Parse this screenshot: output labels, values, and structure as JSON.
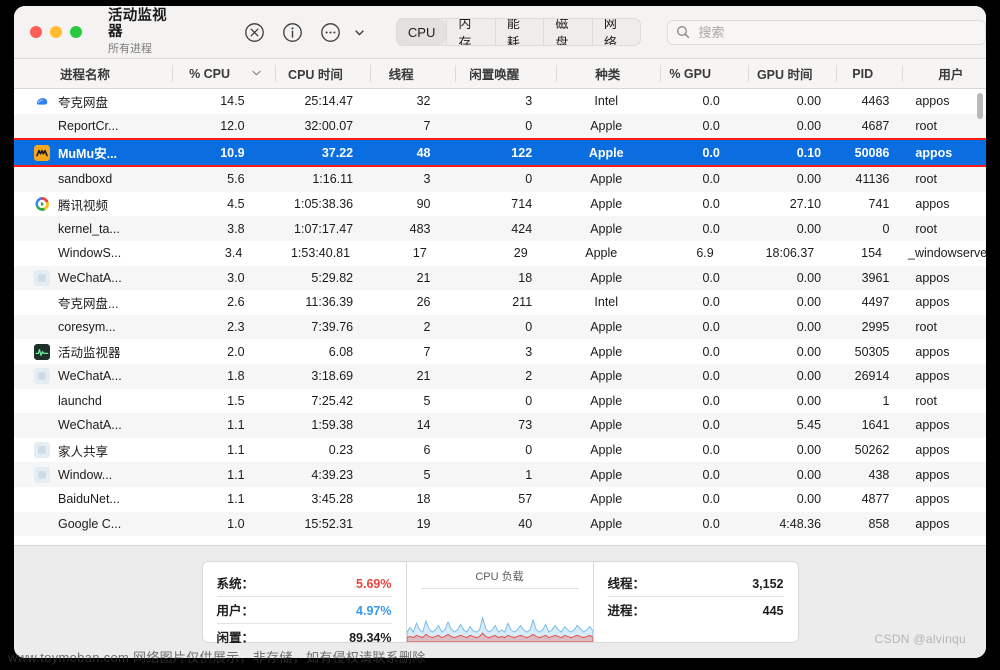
{
  "window": {
    "title": "活动监视器",
    "subtitle": "所有进程",
    "traffic_lights": [
      "close",
      "minimize",
      "maximize"
    ]
  },
  "toolbar": {
    "icons": [
      {
        "name": "stop-process-icon",
        "glyph": "x-circle"
      },
      {
        "name": "inspect-process-icon",
        "glyph": "i-circle"
      },
      {
        "name": "more-options-icon",
        "glyph": "ellipsis-circle"
      },
      {
        "name": "chevron-down-icon",
        "glyph": "chevron-down"
      }
    ],
    "tabs": [
      {
        "label": "CPU",
        "active": true
      },
      {
        "label": "内存",
        "active": false
      },
      {
        "label": "能耗",
        "active": false
      },
      {
        "label": "磁盘",
        "active": false
      },
      {
        "label": "网络",
        "active": false
      }
    ],
    "search": {
      "placeholder": "搜索",
      "value": ""
    }
  },
  "table": {
    "columns": [
      {
        "key": "name",
        "label": "进程名称"
      },
      {
        "key": "cpu",
        "label": "% CPU",
        "sorted": true,
        "sort_dir": "desc"
      },
      {
        "key": "cputime",
        "label": "CPU 时间"
      },
      {
        "key": "threads",
        "label": "线程"
      },
      {
        "key": "idlewake",
        "label": "闲置唤醒"
      },
      {
        "key": "kind",
        "label": "种类"
      },
      {
        "key": "gpu",
        "label": "% GPU"
      },
      {
        "key": "gputime",
        "label": "GPU 时间"
      },
      {
        "key": "pid",
        "label": "PID"
      },
      {
        "key": "user",
        "label": "用户"
      }
    ],
    "rows": [
      {
        "icon": "quark-cloud",
        "icon_color": "#2f80f0",
        "name": "夸克网盘",
        "cpu": "14.5",
        "cputime": "25:14.47",
        "threads": "32",
        "idlewake": "3",
        "kind": "Intel",
        "gpu": "0.0",
        "gputime": "0.00",
        "pid": "4463",
        "user": "appos",
        "selected": false
      },
      {
        "icon": "none",
        "icon_color": "",
        "name": "ReportCr...",
        "cpu": "12.0",
        "cputime": "32:00.07",
        "threads": "7",
        "idlewake": "0",
        "kind": "Apple",
        "gpu": "0.0",
        "gputime": "0.00",
        "pid": "4687",
        "user": "root",
        "selected": false
      },
      {
        "icon": "mumu",
        "icon_color": "#f5a623",
        "name": "MuMu安...",
        "cpu": "10.9",
        "cputime": "37.22",
        "threads": "48",
        "idlewake": "122",
        "kind": "Apple",
        "gpu": "0.0",
        "gputime": "0.10",
        "pid": "50086",
        "user": "appos",
        "selected": true
      },
      {
        "icon": "none",
        "icon_color": "",
        "name": "sandboxd",
        "cpu": "5.6",
        "cputime": "1:16.11",
        "threads": "3",
        "idlewake": "0",
        "kind": "Apple",
        "gpu": "0.0",
        "gputime": "0.00",
        "pid": "41136",
        "user": "root",
        "selected": false
      },
      {
        "icon": "tencent-video",
        "icon_color": "#ffffff",
        "name": "腾讯视频",
        "cpu": "4.5",
        "cputime": "1:05:38.36",
        "threads": "90",
        "idlewake": "714",
        "kind": "Apple",
        "gpu": "0.0",
        "gputime": "27.10",
        "pid": "741",
        "user": "appos",
        "selected": false
      },
      {
        "icon": "none",
        "icon_color": "",
        "name": "kernel_ta...",
        "cpu": "3.8",
        "cputime": "1:07:17.47",
        "threads": "483",
        "idlewake": "424",
        "kind": "Apple",
        "gpu": "0.0",
        "gputime": "0.00",
        "pid": "0",
        "user": "root",
        "selected": false
      },
      {
        "icon": "none",
        "icon_color": "",
        "name": "WindowS...",
        "cpu": "3.4",
        "cputime": "1:53:40.81",
        "threads": "17",
        "idlewake": "29",
        "kind": "Apple",
        "gpu": "6.9",
        "gputime": "18:06.37",
        "pid": "154",
        "user": "_windowserver",
        "selected": false
      },
      {
        "icon": "generic-app",
        "icon_color": "#dfe7ef",
        "name": "WeChatA...",
        "cpu": "3.0",
        "cputime": "5:29.82",
        "threads": "21",
        "idlewake": "18",
        "kind": "Apple",
        "gpu": "0.0",
        "gputime": "0.00",
        "pid": "3961",
        "user": "appos",
        "selected": false
      },
      {
        "icon": "none",
        "icon_color": "",
        "name": "夸克网盘...",
        "cpu": "2.6",
        "cputime": "11:36.39",
        "threads": "26",
        "idlewake": "211",
        "kind": "Intel",
        "gpu": "0.0",
        "gputime": "0.00",
        "pid": "4497",
        "user": "appos",
        "selected": false
      },
      {
        "icon": "none",
        "icon_color": "",
        "name": "coresym...",
        "cpu": "2.3",
        "cputime": "7:39.76",
        "threads": "2",
        "idlewake": "0",
        "kind": "Apple",
        "gpu": "0.0",
        "gputime": "0.00",
        "pid": "2995",
        "user": "root",
        "selected": false
      },
      {
        "icon": "activity-monitor",
        "icon_color": "#1f3b33",
        "name": "活动监视器",
        "cpu": "2.0",
        "cputime": "6.08",
        "threads": "7",
        "idlewake": "3",
        "kind": "Apple",
        "gpu": "0.0",
        "gputime": "0.00",
        "pid": "50305",
        "user": "appos",
        "selected": false
      },
      {
        "icon": "generic-app",
        "icon_color": "#dfe7ef",
        "name": "WeChatA...",
        "cpu": "1.8",
        "cputime": "3:18.69",
        "threads": "21",
        "idlewake": "2",
        "kind": "Apple",
        "gpu": "0.0",
        "gputime": "0.00",
        "pid": "26914",
        "user": "appos",
        "selected": false
      },
      {
        "icon": "none",
        "icon_color": "",
        "name": "launchd",
        "cpu": "1.5",
        "cputime": "7:25.42",
        "threads": "5",
        "idlewake": "0",
        "kind": "Apple",
        "gpu": "0.0",
        "gputime": "0.00",
        "pid": "1",
        "user": "root",
        "selected": false
      },
      {
        "icon": "none",
        "icon_color": "",
        "name": "WeChatA...",
        "cpu": "1.1",
        "cputime": "1:59.38",
        "threads": "14",
        "idlewake": "73",
        "kind": "Apple",
        "gpu": "0.0",
        "gputime": "5.45",
        "pid": "1641",
        "user": "appos",
        "selected": false
      },
      {
        "icon": "generic-app",
        "icon_color": "#dfe7ef",
        "name": "家人共享",
        "cpu": "1.1",
        "cputime": "0.23",
        "threads": "6",
        "idlewake": "0",
        "kind": "Apple",
        "gpu": "0.0",
        "gputime": "0.00",
        "pid": "50262",
        "user": "appos",
        "selected": false
      },
      {
        "icon": "generic-app",
        "icon_color": "#dfe7ef",
        "name": "Window...",
        "cpu": "1.1",
        "cputime": "4:39.23",
        "threads": "5",
        "idlewake": "1",
        "kind": "Apple",
        "gpu": "0.0",
        "gputime": "0.00",
        "pid": "438",
        "user": "appos",
        "selected": false
      },
      {
        "icon": "none",
        "icon_color": "",
        "name": "BaiduNet...",
        "cpu": "1.1",
        "cputime": "3:45.28",
        "threads": "18",
        "idlewake": "57",
        "kind": "Apple",
        "gpu": "0.0",
        "gputime": "0.00",
        "pid": "4877",
        "user": "appos",
        "selected": false
      },
      {
        "icon": "none",
        "icon_color": "",
        "name": "Google C...",
        "cpu": "1.0",
        "cputime": "15:52.31",
        "threads": "19",
        "idlewake": "40",
        "kind": "Apple",
        "gpu": "0.0",
        "gputime": "4:48.36",
        "pid": "858",
        "user": "appos",
        "selected": false
      }
    ]
  },
  "footer": {
    "cpu_stats": [
      {
        "label": "系统：",
        "value": "5.69%",
        "color_class": "red"
      },
      {
        "label": "用户：",
        "value": "4.97%",
        "color_class": "blue"
      },
      {
        "label": "闲置：",
        "value": "89.34%",
        "color_class": "dark"
      }
    ],
    "graph": {
      "title": "CPU 负载"
    },
    "counts": [
      {
        "label": "线程：",
        "value": "3,152"
      },
      {
        "label": "进程：",
        "value": "445"
      }
    ]
  },
  "chart_data": {
    "type": "area",
    "title": "CPU 负载",
    "xlabel": "",
    "ylabel": "",
    "ylim": [
      0,
      100
    ],
    "grid": false,
    "legend": "none",
    "series": [
      {
        "name": "系统",
        "color": "#e8453c",
        "values": [
          4,
          5,
          4,
          6,
          5,
          4,
          7,
          5,
          4,
          5,
          6,
          4,
          5,
          7,
          5,
          4,
          5,
          6,
          5,
          4,
          6,
          5,
          4,
          5,
          8,
          5,
          4,
          5,
          6,
          4,
          5,
          4,
          6,
          5,
          4,
          5,
          6,
          5,
          4,
          5,
          7,
          5,
          4,
          5,
          6,
          4,
          5,
          6,
          5,
          4,
          6,
          5,
          4,
          5,
          6,
          5,
          4,
          5,
          6,
          4
        ]
      },
      {
        "name": "用户",
        "color": "#6fb7e8",
        "values": [
          9,
          13,
          9,
          17,
          11,
          9,
          19,
          12,
          9,
          11,
          15,
          9,
          11,
          18,
          12,
          9,
          11,
          16,
          11,
          9,
          14,
          10,
          9,
          11,
          22,
          12,
          9,
          11,
          15,
          9,
          11,
          9,
          17,
          11,
          9,
          11,
          15,
          11,
          9,
          11,
          20,
          11,
          9,
          11,
          16,
          9,
          11,
          15,
          11,
          9,
          14,
          11,
          9,
          11,
          15,
          12,
          9,
          11,
          14,
          10
        ]
      }
    ]
  },
  "watermarks": {
    "left": "www.toymoban.com 网络图片仅供展示，非存储，如有侵权请联系删除",
    "right": "CSDN @alvinqu"
  }
}
